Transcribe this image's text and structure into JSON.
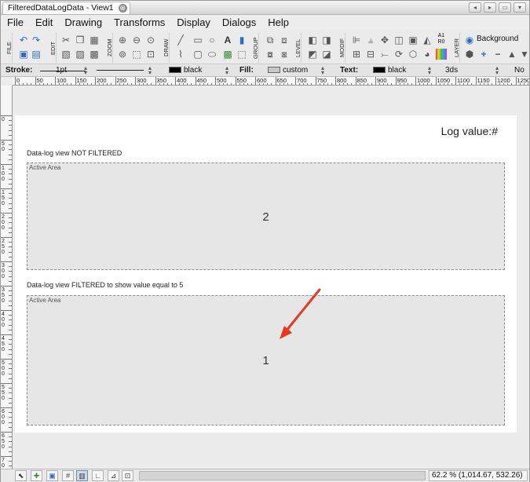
{
  "window": {
    "tab_title": "FilteredDataLogData - View1",
    "tab_close": "⊗",
    "controls": [
      "◂",
      "▸",
      "▭",
      "▾"
    ]
  },
  "menu": [
    "File",
    "Edit",
    "Drawing",
    "Transforms",
    "Display",
    "Dialogs",
    "Help"
  ],
  "toolbar": {
    "groups": [
      "FILE",
      "EDIT",
      "ZOOM",
      "DRAW",
      "GROUP",
      "LEVEL",
      "MODIF",
      "LAYER"
    ],
    "background_label": "Background",
    "a1r0_label": "A1 R0"
  },
  "properties": {
    "stroke_label": "Stroke:",
    "stroke_width": "1pt",
    "stroke_color": "black",
    "fill_label": "Fill:",
    "fill_value": "custom",
    "text_label": "Text:",
    "text_color": "black",
    "font_value": "3ds",
    "last_value": "No",
    "colors": {
      "black": "#000000",
      "custom": "#c8c8c8"
    }
  },
  "ruler": {
    "h_labels": [
      "0",
      "50",
      "100",
      "150",
      "200",
      "250",
      "300",
      "350",
      "400",
      "450",
      "500",
      "550",
      "600",
      "650",
      "700",
      "750",
      "800",
      "850",
      "900",
      "950",
      "1000",
      "1050",
      "1100",
      "1150",
      "1200",
      "1250"
    ],
    "v_labels": [
      "0",
      "50",
      "100",
      "150",
      "200",
      "250",
      "300",
      "350",
      "400",
      "450",
      "500",
      "550",
      "600",
      "650",
      "700"
    ]
  },
  "canvas": {
    "log_value_label": "Log value:#",
    "section1_label": "Data-log view NOT FILTERED",
    "section2_label": "Data-log view FILTERED to show value equal to 5",
    "area1": {
      "label": "Active Area",
      "value": "2"
    },
    "area2": {
      "label": "Active Area",
      "value": "1"
    },
    "arrow_color": "#e8381f"
  },
  "status": {
    "zoom_coords": "62.2 % (1,014.67, 532.26)"
  }
}
